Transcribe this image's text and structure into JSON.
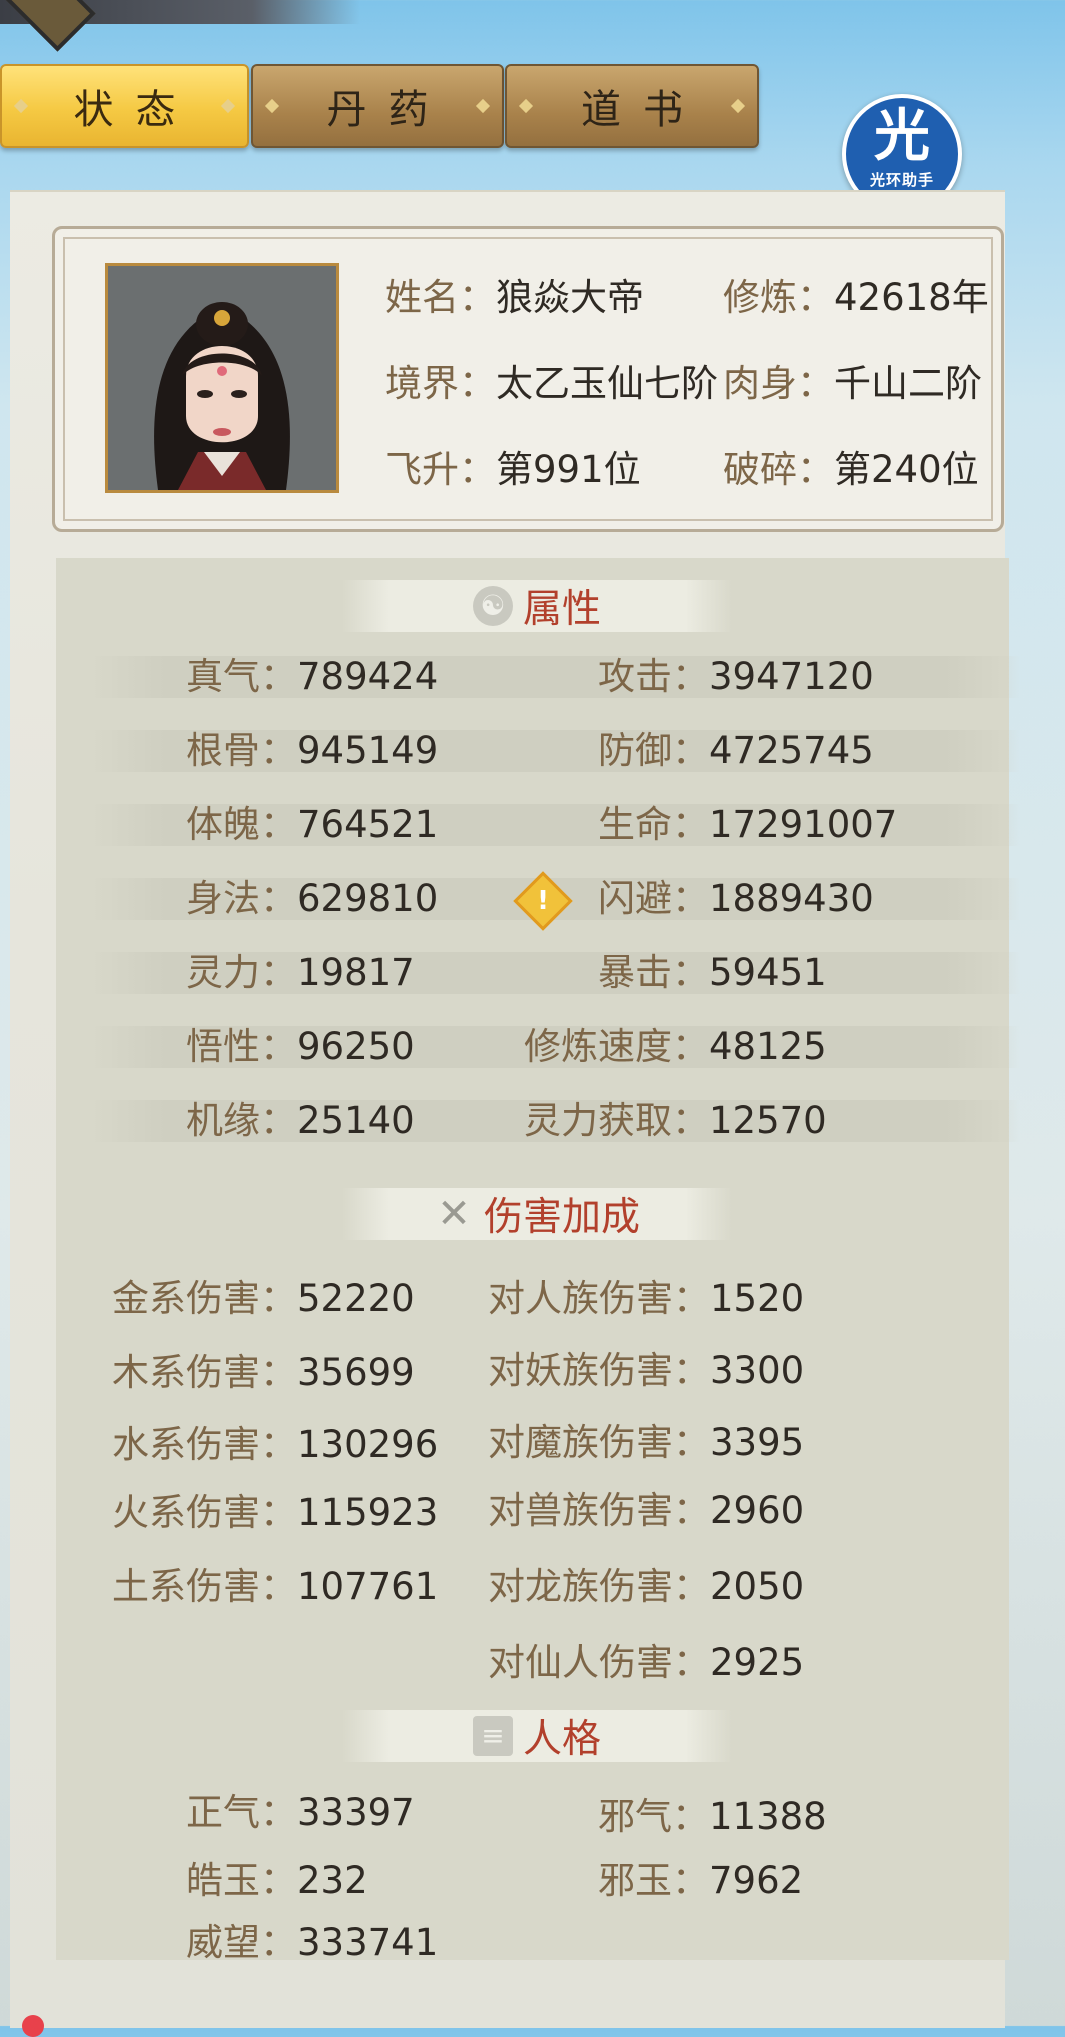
{
  "tabs": [
    {
      "label": "状态",
      "active": true
    },
    {
      "label": "丹药",
      "active": false
    },
    {
      "label": "道书",
      "active": false
    }
  ],
  "watermark": {
    "glyph": "光",
    "text": "光环助手"
  },
  "profile": {
    "name_label": "姓名：",
    "name": "狼焱大帝",
    "cultivate_label": "修炼：",
    "cultivate": "42618年",
    "realm_label": "境界：",
    "realm": "太乙玉仙七阶",
    "body_label": "肉身：",
    "body": "千山二阶",
    "ascend_label": "飞升：",
    "ascend": "第991位",
    "shatter_label": "破碎：",
    "shatter": "第240位"
  },
  "attributes": {
    "title": "属性",
    "icon": "yin-yang-icon",
    "rows": [
      {
        "l_label": "真气：",
        "l_value": "789424",
        "r_label": "攻击：",
        "r_value": "3947120"
      },
      {
        "l_label": "根骨：",
        "l_value": "945149",
        "r_label": "防御：",
        "r_value": "4725745"
      },
      {
        "l_label": "体魄：",
        "l_value": "764521",
        "r_label": "生命：",
        "r_value": "17291007"
      },
      {
        "l_label": "身法：",
        "l_value": "629810",
        "r_label": "闪避：",
        "r_value": "1889430"
      },
      {
        "l_label": "灵力：",
        "l_value": "19817",
        "r_label": "暴击：",
        "r_value": "59451"
      },
      {
        "l_label": "悟性：",
        "l_value": "96250",
        "r_label": "修炼速度：",
        "r_value": "48125"
      },
      {
        "l_label": "机缘：",
        "l_value": "25140",
        "r_label": "灵力获取：",
        "r_value": "12570"
      }
    ]
  },
  "damage": {
    "title": "伤害加成",
    "icon": "crossed-swords-icon",
    "left": [
      {
        "label": "金系伤害：",
        "value": "52220"
      },
      {
        "label": "木系伤害：",
        "value": "35699"
      },
      {
        "label": "水系伤害：",
        "value": "130296"
      },
      {
        "label": "火系伤害：",
        "value": "115923"
      },
      {
        "label": "土系伤害：",
        "value": "107761"
      }
    ],
    "right": [
      {
        "label": "对人族伤害：",
        "value": "1520"
      },
      {
        "label": "对妖族伤害：",
        "value": "3300"
      },
      {
        "label": "对魔族伤害：",
        "value": "3395"
      },
      {
        "label": "对兽族伤害：",
        "value": "2960"
      },
      {
        "label": "对龙族伤害：",
        "value": "2050"
      },
      {
        "label": "对仙人伤害：",
        "value": "2925"
      }
    ]
  },
  "personality": {
    "title": "人格",
    "icon": "scroll-icon",
    "rows": [
      {
        "l_label": "正气：",
        "l_value": "33397",
        "r_label": "邪气：",
        "r_value": "11388"
      },
      {
        "l_label": "皓玉：",
        "l_value": "232",
        "r_label": "邪玉：",
        "r_value": "7962"
      },
      {
        "l_label": "威望：",
        "l_value": "333741"
      }
    ]
  },
  "colors": {
    "accent_red": "#b2402c",
    "label_brown": "#7d6648",
    "tab_gold": "#f5c943"
  }
}
